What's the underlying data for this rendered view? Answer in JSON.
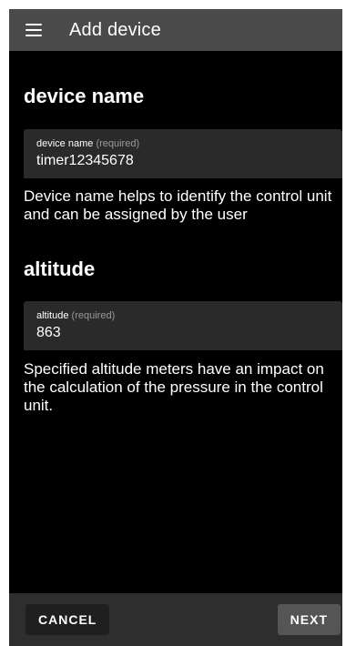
{
  "app_bar": {
    "menu_icon": "hamburger-menu-icon",
    "title": "Add device"
  },
  "device_name_section": {
    "heading": "device name",
    "field": {
      "label": "device name",
      "required_tag": "(required)",
      "value": "timer12345678"
    },
    "help_text": "Device name helps to identify the control unit and can be assigned by the user"
  },
  "altitude_section": {
    "heading": "altitude",
    "field": {
      "label": "altitude",
      "required_tag": "(required)",
      "value": "863"
    },
    "help_text": "Specified altitude meters have an impact on the calculation of the pressure in the control unit."
  },
  "bottom_bar": {
    "cancel_label": "CANCEL",
    "next_label": "NEXT"
  }
}
